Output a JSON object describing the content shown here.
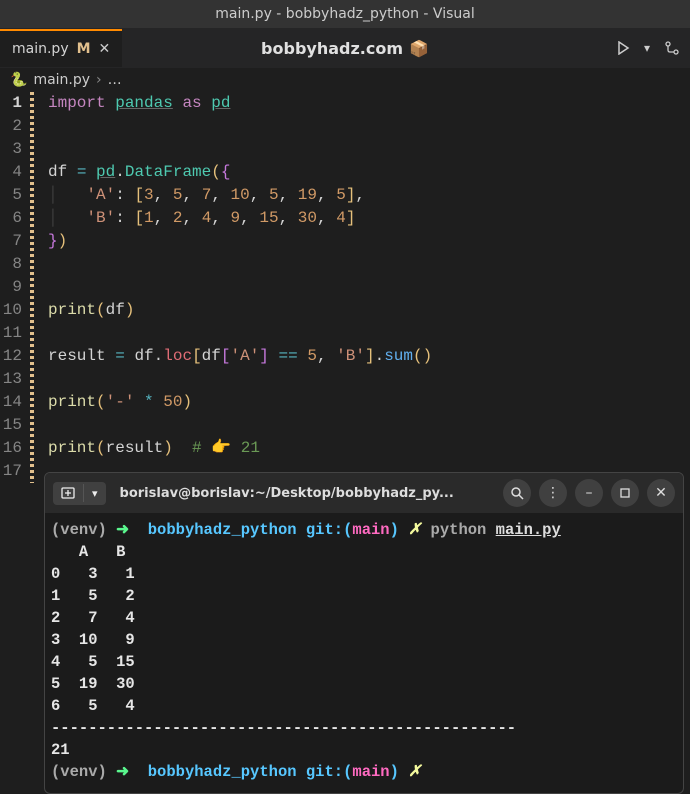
{
  "window_title": "main.py - bobbyhadz_python - Visual",
  "tab": {
    "filename": "main.py",
    "modified_marker": "M"
  },
  "site_label": "bobbyhadz.com",
  "breadcrumb": {
    "filename": "main.py"
  },
  "code": {
    "lines": [
      "import pandas as pd",
      "",
      "",
      "df = pd.DataFrame({",
      "    'A': [3, 5, 7, 10, 5, 19, 5],",
      "    'B': [1, 2, 4, 9, 15, 30, 4]",
      "})",
      "",
      "",
      "print(df)",
      "",
      "result = df.loc[df['A'] == 5, 'B'].sum()",
      "",
      "print('-' * 50)",
      "",
      "print(result)  # 👉 21",
      ""
    ]
  },
  "terminal": {
    "title": "borislav@borislav:~/Desktop/bobbyhadz_py...",
    "venv_label": "(venv)",
    "prompt_dir": "bobbyhadz_python",
    "git_label": "git:(",
    "branch": "main",
    "git_close": ")",
    "cancel_mark": "✗",
    "command": "python",
    "command_file": "main.py",
    "output_header": "   A   B",
    "output_rows": [
      "0   3   1",
      "1   5   2",
      "2   7   4",
      "3  10   9",
      "4   5  15",
      "5  19  30",
      "6   5   4"
    ],
    "separator": "--------------------------------------------------",
    "result": "21"
  }
}
